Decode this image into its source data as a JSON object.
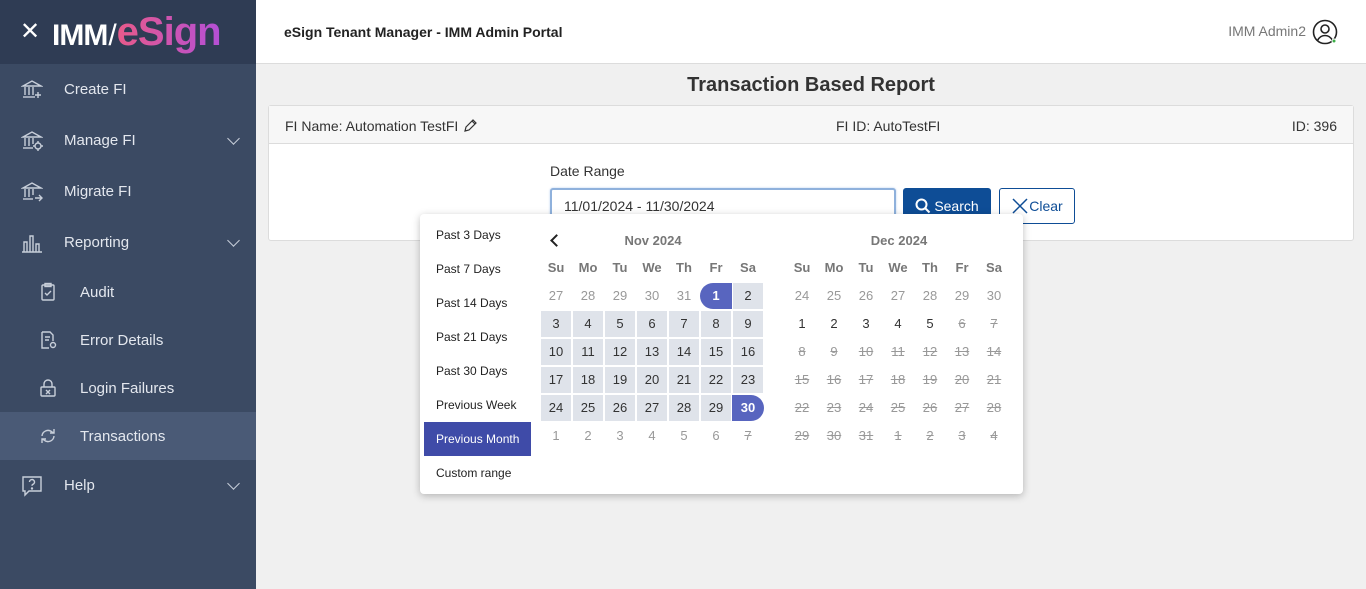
{
  "brand": {
    "imm": "IMM",
    "slash": "/",
    "esign": "eSign"
  },
  "header": {
    "title": "eSign Tenant Manager - IMM Admin Portal",
    "user": "IMM Admin2"
  },
  "sidebar": {
    "items": [
      {
        "label": "Create FI",
        "icon": "bank-plus-icon"
      },
      {
        "label": "Manage FI",
        "icon": "bank-gear-icon"
      },
      {
        "label": "Migrate FI",
        "icon": "bank-arrow-icon"
      },
      {
        "label": "Reporting",
        "icon": "bar-chart-icon"
      }
    ],
    "reporting_sub": [
      {
        "label": "Audit",
        "icon": "clipboard-check-icon"
      },
      {
        "label": "Error Details",
        "icon": "document-gear-icon"
      },
      {
        "label": "Login Failures",
        "icon": "lock-x-icon"
      },
      {
        "label": "Transactions",
        "icon": "cycle-arrows-icon"
      }
    ],
    "help": {
      "label": "Help",
      "icon": "help-bubble-icon"
    }
  },
  "page": {
    "title": "Transaction Based Report"
  },
  "info": {
    "fi_name": "FI Name: Automation TestFI",
    "fi_id": "FI ID: AutoTestFI",
    "id": "ID: 396"
  },
  "form": {
    "date_label": "Date Range",
    "date_value": "11/01/2024 - 11/30/2024",
    "search_label": "Search",
    "clear_label": "Clear"
  },
  "picker": {
    "ranges": [
      "Past 3 Days",
      "Past 7 Days",
      "Past 14 Days",
      "Past 21 Days",
      "Past 30 Days",
      "Previous Week",
      "Previous Month",
      "Custom range"
    ],
    "active_range": "Previous Month",
    "weekdays": [
      "Su",
      "Mo",
      "Tu",
      "We",
      "Th",
      "Fr",
      "Sa"
    ],
    "left_month": "Nov 2024",
    "right_month": "Dec 2024",
    "left_days": [
      "27",
      "28",
      "29",
      "30",
      "31",
      "1",
      "2",
      "3",
      "4",
      "5",
      "6",
      "7",
      "8",
      "9",
      "10",
      "11",
      "12",
      "13",
      "14",
      "15",
      "16",
      "17",
      "18",
      "19",
      "20",
      "21",
      "22",
      "23",
      "24",
      "25",
      "26",
      "27",
      "28",
      "29",
      "30",
      "1",
      "2",
      "3",
      "4",
      "5",
      "6",
      "7"
    ],
    "right_days": [
      "24",
      "25",
      "26",
      "27",
      "28",
      "29",
      "30",
      "1",
      "2",
      "3",
      "4",
      "5",
      "6",
      "7",
      "8",
      "9",
      "10",
      "11",
      "12",
      "13",
      "14",
      "15",
      "16",
      "17",
      "18",
      "19",
      "20",
      "21",
      "22",
      "23",
      "24",
      "25",
      "26",
      "27",
      "28",
      "29",
      "30",
      "31",
      "1",
      "2",
      "3",
      "4"
    ]
  },
  "colors": {
    "sidebar": "#3b4a63",
    "brand_bar": "#2f3c54",
    "primary": "#0e4d96",
    "range_active": "#3f4ba8",
    "selected_day": "#5865bf"
  }
}
